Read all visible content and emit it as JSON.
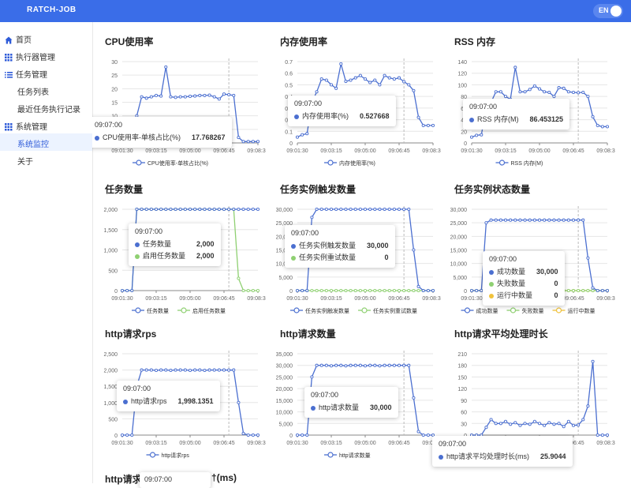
{
  "app": {
    "brand": "RATCH-JOB",
    "lang": "EN"
  },
  "sidebar": [
    {
      "name": "home",
      "label": "首页",
      "icon": "home-icon",
      "sub": false,
      "active": false
    },
    {
      "name": "executor-management",
      "label": "执行器管理",
      "icon": "grid-icon",
      "sub": false,
      "active": false
    },
    {
      "name": "task-management",
      "label": "任务管理",
      "icon": "list-icon",
      "sub": false,
      "active": false
    },
    {
      "name": "task-list",
      "label": "任务列表",
      "icon": "",
      "sub": true,
      "active": false
    },
    {
      "name": "recent-executions",
      "label": "最近任务执行记录",
      "icon": "",
      "sub": true,
      "active": false
    },
    {
      "name": "system-management",
      "label": "系统管理",
      "icon": "grid-icon",
      "sub": false,
      "active": false
    },
    {
      "name": "system-monitor",
      "label": "系统监控",
      "icon": "",
      "sub": true,
      "active": true
    },
    {
      "name": "about",
      "label": "关于",
      "icon": "",
      "sub": true,
      "active": false
    }
  ],
  "charts": [
    {
      "title": "CPU使用率",
      "y_ticks": [
        "0",
        "5",
        "10",
        "15",
        "20",
        "25",
        "30"
      ],
      "ylim": [
        0,
        30
      ],
      "x_labels": [
        "09:01:30",
        "09:03:15",
        "09:05:00",
        "09:06:45",
        "09:08:30"
      ],
      "series": [
        {
          "name": "CPU使用率-单核占比(%)",
          "color": "#4b6fd0",
          "values": [
            0.5,
            0.8,
            1,
            10,
            17,
            16.5,
            17,
            17.5,
            17.3,
            28,
            17,
            16.8,
            17,
            17,
            17.2,
            17.3,
            17.5,
            17.5,
            17.6,
            17,
            16.2,
            18,
            17.8,
            17.5,
            2,
            0.5,
            0.5,
            0.5,
            0.5
          ]
        }
      ],
      "tooltip": {
        "time": "09:07:00",
        "rows": [
          {
            "label": "CPU使用率-单核占比(%)",
            "value": "17.768267",
            "color": "#4b6fd0"
          }
        ]
      }
    },
    {
      "title": "内存使用率",
      "y_ticks": [
        "0",
        "0.1",
        "0.2",
        "0.3",
        "0.4",
        "0.5",
        "0.6",
        "0.7"
      ],
      "ylim": [
        0,
        0.7
      ],
      "x_labels": [
        "09:01:30",
        "09:03:15",
        "09:05:00",
        "09:06:45",
        "09:08:30"
      ],
      "series": [
        {
          "name": "内存使用率(%)",
          "color": "#4b6fd0",
          "values": [
            0.05,
            0.07,
            0.08,
            0.35,
            0.44,
            0.55,
            0.54,
            0.5,
            0.47,
            0.68,
            0.53,
            0.54,
            0.56,
            0.58,
            0.55,
            0.52,
            0.54,
            0.5,
            0.58,
            0.56,
            0.55,
            0.56,
            0.527,
            0.5,
            0.45,
            0.22,
            0.15,
            0.15,
            0.15
          ]
        }
      ],
      "tooltip": {
        "time": "09:07:00",
        "rows": [
          {
            "label": "内存使用率(%)",
            "value": "0.527668",
            "color": "#4b6fd0"
          }
        ]
      }
    },
    {
      "title": "RSS 内存",
      "y_ticks": [
        "0",
        "20",
        "40",
        "60",
        "80",
        "100",
        "120",
        "140"
      ],
      "ylim": [
        0,
        140
      ],
      "x_labels": [
        "09:01:30",
        "09:03:15",
        "09:05:00",
        "09:06:45",
        "09:08:30"
      ],
      "series": [
        {
          "name": "RSS 内存(M)",
          "color": "#4b6fd0",
          "values": [
            10,
            13,
            14,
            60,
            70,
            88,
            88,
            80,
            75,
            130,
            88,
            88,
            92,
            98,
            93,
            88,
            87,
            80,
            95,
            94,
            88,
            87,
            86.45,
            87,
            80,
            45,
            30,
            28,
            28
          ]
        }
      ],
      "tooltip": {
        "time": "09:07:00",
        "rows": [
          {
            "label": "RSS 内存(M)",
            "value": "86.453125",
            "color": "#4b6fd0"
          }
        ]
      }
    },
    {
      "title": "任务数量",
      "y_ticks": [
        "0",
        "500",
        "1,000",
        "1,500",
        "2,000"
      ],
      "ylim": [
        0,
        2000
      ],
      "x_labels": [
        "09:01:30",
        "09:03:15",
        "09:05:00",
        "09:06:45",
        "09:08:30"
      ],
      "series": [
        {
          "name": "任务数量",
          "color": "#4b6fd0",
          "values": [
            0,
            0,
            0,
            2000,
            2000,
            2000,
            2000,
            2000,
            2000,
            2000,
            2000,
            2000,
            2000,
            2000,
            2000,
            2000,
            2000,
            2000,
            2000,
            2000,
            2000,
            2000,
            2000,
            2000,
            2000,
            2000,
            2000,
            2000,
            2000
          ]
        },
        {
          "name": "启用任务数量",
          "color": "#8fd072",
          "values": [
            0,
            0,
            0,
            2000,
            2000,
            2000,
            2000,
            2000,
            2000,
            2000,
            2000,
            2000,
            2000,
            2000,
            2000,
            2000,
            2000,
            2000,
            2000,
            2000,
            2000,
            2000,
            2000,
            2000,
            300,
            0,
            0,
            0,
            0
          ]
        }
      ],
      "tooltip": {
        "time": "09:07:00",
        "rows": [
          {
            "label": "任务数量",
            "value": "2,000",
            "color": "#4b6fd0"
          },
          {
            "label": "启用任务数量",
            "value": "2,000",
            "color": "#8fd072"
          }
        ]
      }
    },
    {
      "title": "任务实例触发数量",
      "y_ticks": [
        "0",
        "5,000",
        "10,000",
        "15,000",
        "20,000",
        "25,000",
        "30,000"
      ],
      "ylim": [
        0,
        30000
      ],
      "x_labels": [
        "09:01:30",
        "09:03:15",
        "09:05:00",
        "09:06:45",
        "09:08:30"
      ],
      "series": [
        {
          "name": "任务实例触发数量",
          "color": "#4b6fd0",
          "values": [
            0,
            0,
            0,
            27000,
            30000,
            30000,
            30000,
            30000,
            30000,
            30000,
            30000,
            30000,
            30000,
            30000,
            30000,
            30000,
            30000,
            30000,
            30000,
            30000,
            30000,
            30000,
            30000,
            30000,
            15000,
            1500,
            0,
            0,
            0
          ]
        },
        {
          "name": "任务实例重试数量",
          "color": "#8fd072",
          "values": [
            0,
            0,
            0,
            0,
            0,
            0,
            0,
            0,
            0,
            0,
            0,
            0,
            0,
            0,
            0,
            0,
            0,
            0,
            0,
            0,
            0,
            0,
            0,
            0,
            0,
            0,
            0,
            0,
            0
          ]
        }
      ],
      "tooltip": {
        "time": "09:07:00",
        "rows": [
          {
            "label": "任务实例触发数量",
            "value": "30,000",
            "color": "#4b6fd0"
          },
          {
            "label": "任务实例重试数量",
            "value": "0",
            "color": "#8fd072"
          }
        ]
      }
    },
    {
      "title": "任务实例状态数量",
      "y_ticks": [
        "0",
        "5,000",
        "10,000",
        "15,000",
        "20,000",
        "25,000",
        "30,000"
      ],
      "ylim": [
        0,
        30000
      ],
      "x_labels": [
        "09:01:30",
        "09:03:15",
        "09:05:00",
        "09:06:45",
        "09:08:30"
      ],
      "series": [
        {
          "name": "成功数量",
          "color": "#4b6fd0",
          "values": [
            0,
            0,
            0,
            25000,
            26000,
            26000,
            26000,
            26000,
            26000,
            26000,
            26000,
            26000,
            26000,
            26000,
            26000,
            26000,
            26000,
            26000,
            26000,
            26000,
            26000,
            26000,
            26000,
            26000,
            12000,
            1000,
            0,
            0,
            0
          ]
        },
        {
          "name": "失败数量",
          "color": "#8fd072",
          "values": [
            0,
            0,
            0,
            0,
            0,
            0,
            0,
            0,
            0,
            0,
            0,
            0,
            0,
            0,
            0,
            0,
            0,
            0,
            0,
            0,
            0,
            0,
            0,
            0,
            0,
            0,
            0,
            0,
            0
          ]
        },
        {
          "name": "运行中数量",
          "color": "#f0c23b",
          "values": [
            0,
            0,
            0,
            0,
            0,
            0,
            0,
            0,
            0,
            0,
            0,
            0,
            0,
            0,
            0,
            0,
            0,
            0,
            0,
            0,
            0,
            0,
            0,
            0,
            0,
            0,
            0,
            0,
            0
          ]
        }
      ],
      "tooltip": {
        "time": "09:07:00",
        "rows": [
          {
            "label": "成功数量",
            "value": "30,000",
            "color": "#4b6fd0"
          },
          {
            "label": "失败数量",
            "value": "0",
            "color": "#8fd072"
          },
          {
            "label": "运行中数量",
            "value": "0",
            "color": "#f0c23b"
          }
        ]
      }
    },
    {
      "title": "http请求rps",
      "y_ticks": [
        "0",
        "500",
        "1,000",
        "1,500",
        "2,000",
        "2,500"
      ],
      "ylim": [
        0,
        2500
      ],
      "x_labels": [
        "09:01:30",
        "09:03:15",
        "09:05:00",
        "09:06:45",
        "09:08:30"
      ],
      "series": [
        {
          "name": "http请求rps",
          "color": "#4b6fd0",
          "values": [
            0,
            0,
            0,
            1500,
            2000,
            2000,
            2000,
            1990,
            2000,
            2000,
            1990,
            2000,
            2000,
            2000,
            1990,
            2000,
            2000,
            1990,
            2000,
            2000,
            2000,
            2000,
            1998,
            2000,
            1000,
            50,
            0,
            0,
            0
          ]
        }
      ],
      "tooltip": {
        "time": "09:07:00",
        "rows": [
          {
            "label": "http请求rps",
            "value": "1,998.1351",
            "color": "#4b6fd0"
          }
        ]
      }
    },
    {
      "title": "http请求数量",
      "y_ticks": [
        "0",
        "5,000",
        "10,000",
        "15,000",
        "20,000",
        "25,000",
        "30,000",
        "35,000"
      ],
      "ylim": [
        0,
        35000
      ],
      "x_labels": [
        "09:01:30",
        "09:03:15",
        "09:05:00",
        "09:06:45",
        "09:08:30"
      ],
      "series": [
        {
          "name": "http请求数量",
          "color": "#4b6fd0",
          "values": [
            0,
            0,
            0,
            25000,
            30000,
            30000,
            30000,
            29800,
            30000,
            30000,
            29800,
            30000,
            30000,
            30000,
            29800,
            30000,
            30000,
            29800,
            30000,
            30000,
            30000,
            30000,
            30000,
            30000,
            16000,
            1500,
            0,
            0,
            0
          ]
        }
      ],
      "tooltip": {
        "time": "09:07:00",
        "rows": [
          {
            "label": "http请求数量",
            "value": "30,000",
            "color": "#4b6fd0"
          }
        ]
      }
    },
    {
      "title": "http请求平均处理时长",
      "y_ticks": [
        "0",
        "30",
        "60",
        "90",
        "120",
        "150",
        "180",
        "210"
      ],
      "ylim": [
        0,
        210
      ],
      "x_labels": [
        "09:01:30",
        "09:03:15",
        "09:05:00",
        "09:06:45",
        "09:08:30"
      ],
      "series": [
        {
          "name": "http请求平均处理时长(ms)",
          "color": "#4b6fd0",
          "values": [
            0,
            0,
            0,
            20,
            40,
            30,
            30,
            35,
            28,
            32,
            25,
            30,
            28,
            35,
            30,
            25,
            32,
            28,
            30,
            22,
            35,
            25,
            26,
            40,
            75,
            190,
            0,
            0,
            0
          ]
        }
      ],
      "tooltip": {
        "time": "09:07:00",
        "rows": [
          {
            "label": "http请求平均处理时长(ms)",
            "value": "25.9044",
            "color": "#4b6fd0"
          }
        ]
      }
    }
  ],
  "partial": {
    "title_start": "http请求",
    "tooltip_time": "09:07:00",
    "title_end": "†(ms)"
  }
}
